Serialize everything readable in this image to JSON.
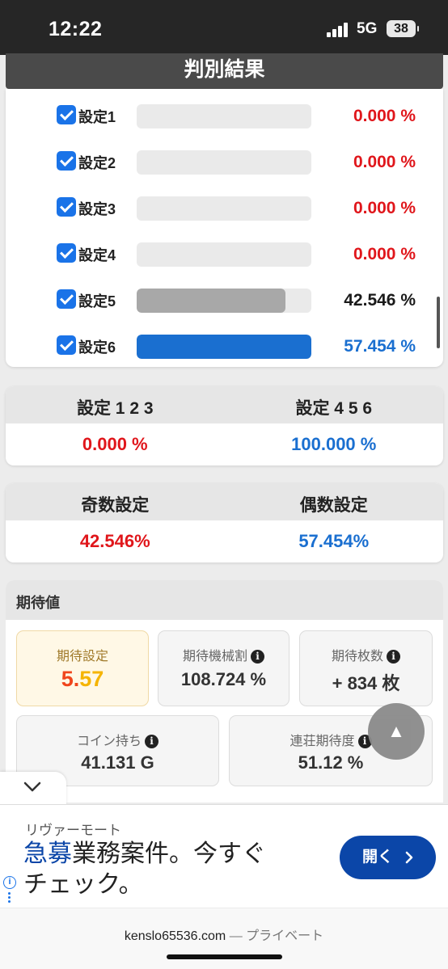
{
  "status_bar": {
    "time": "12:22",
    "network": "5G",
    "battery": "38"
  },
  "result": {
    "title": "判別結果",
    "settings": [
      {
        "label": "設定1",
        "percent": "0.000 %",
        "fraction": 0.0,
        "checked": true,
        "color": "#e0161b"
      },
      {
        "label": "設定2",
        "percent": "0.000 %",
        "fraction": 0.0,
        "checked": true,
        "color": "#e0161b"
      },
      {
        "label": "設定3",
        "percent": "0.000 %",
        "fraction": 0.0,
        "checked": true,
        "color": "#e0161b"
      },
      {
        "label": "設定4",
        "percent": "0.000 %",
        "fraction": 0.0,
        "checked": true,
        "color": "#e0161b"
      },
      {
        "label": "設定5",
        "percent": "42.546 %",
        "fraction": 0.85,
        "checked": true,
        "color": "#1a1a1a",
        "bar_color": "#a8a8a8"
      },
      {
        "label": "設定6",
        "percent": "57.454 %",
        "fraction": 1.0,
        "checked": true,
        "color": "#1a6fd0",
        "bar_color": "#1a6fd0"
      }
    ]
  },
  "low_high": {
    "low_label": "設定 1 2 3",
    "high_label": "設定 4 5 6",
    "low_value": "0.000 %",
    "high_value": "100.000 %"
  },
  "odd_even": {
    "odd_label": "奇数設定",
    "even_label": "偶数設定",
    "odd_value": "42.546%",
    "even_value": "57.454%"
  },
  "expected": {
    "title": "期待値",
    "setting": {
      "label": "期待設定",
      "value_int": "5.",
      "value_dec": "57"
    },
    "payout": {
      "label": "期待機械割",
      "value": "108.724 %"
    },
    "coins": {
      "label": "期待枚数",
      "value": "+ 834 枚"
    },
    "coin_hold": {
      "label": "コイン持ち",
      "value": "41.131 G"
    },
    "streak": {
      "label": "連荘期待度",
      "value": "51.12 %"
    }
  },
  "to_top_glyph": "▲",
  "ad": {
    "brand": "リヴァーモート",
    "headline_accent": "急募",
    "headline_rest": "業務案件。今すぐチェック。",
    "cta": "開く"
  },
  "url_bar": {
    "domain": "kenslo65536.com",
    "separator": " — ",
    "privacy": "プライベート"
  },
  "colors": {
    "red": "#e0161b",
    "blue": "#1a6fd0",
    "gold": "#f5b400"
  }
}
